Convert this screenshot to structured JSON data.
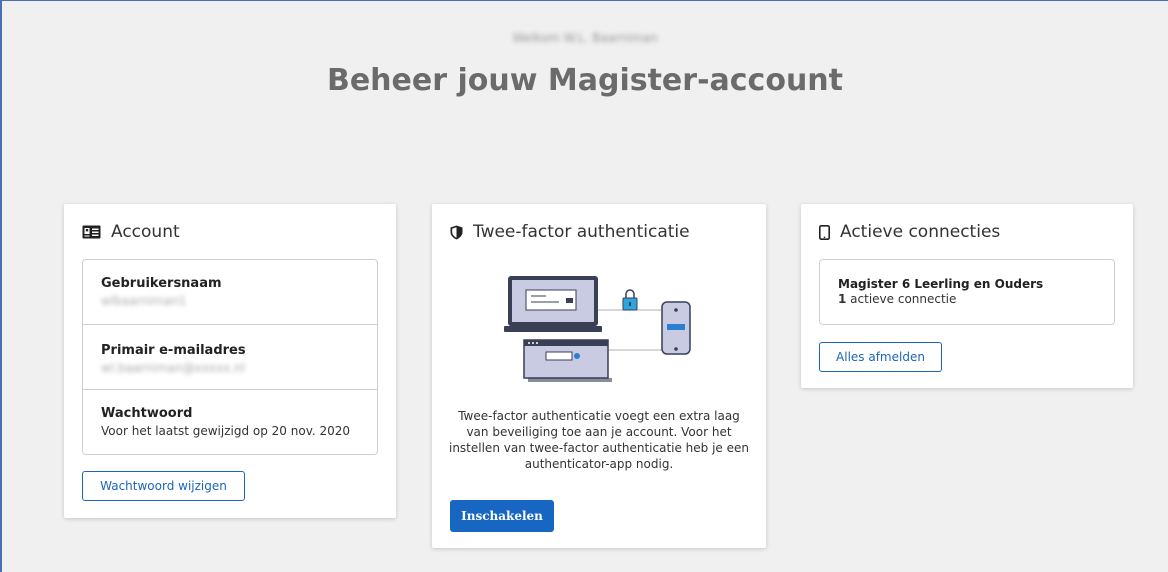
{
  "header": {
    "greeting": "Welkom W.L. Baarniman",
    "title": "Beheer jouw Magister-account"
  },
  "account": {
    "title": "Account",
    "icon": "id-card-icon",
    "rows": [
      {
        "label": "Gebruikersnaam",
        "value": "wlbaarniman1"
      },
      {
        "label": "Primair e-mailadres",
        "value": "wl.baarniman@xxxxx.nl"
      },
      {
        "label": "Wachtwoord",
        "value": "Voor het laatst gewijzigd op 20 nov. 2020"
      }
    ],
    "change_password_button": "Wachtwoord wijzigen"
  },
  "twofa": {
    "title": "Twee-factor authenticatie",
    "icon": "shield-icon",
    "description": "Twee-factor authenticatie voegt een extra laag van beveiliging toe aan je account. Voor het instellen van twee-factor authenticatie heb je een authenticator-app nodig.",
    "enable_button": "Inschakelen"
  },
  "connections": {
    "title": "Actieve connecties",
    "icon": "phone-icon",
    "item_name": "Magister 6 Leerling en Ouders",
    "item_count": "1",
    "item_count_suffix": " actieve connectie",
    "signout_button": "Alles afmelden"
  },
  "colors": {
    "accent": "#1767c2",
    "background": "#f0f0f0",
    "title": "#6b6b6b"
  }
}
